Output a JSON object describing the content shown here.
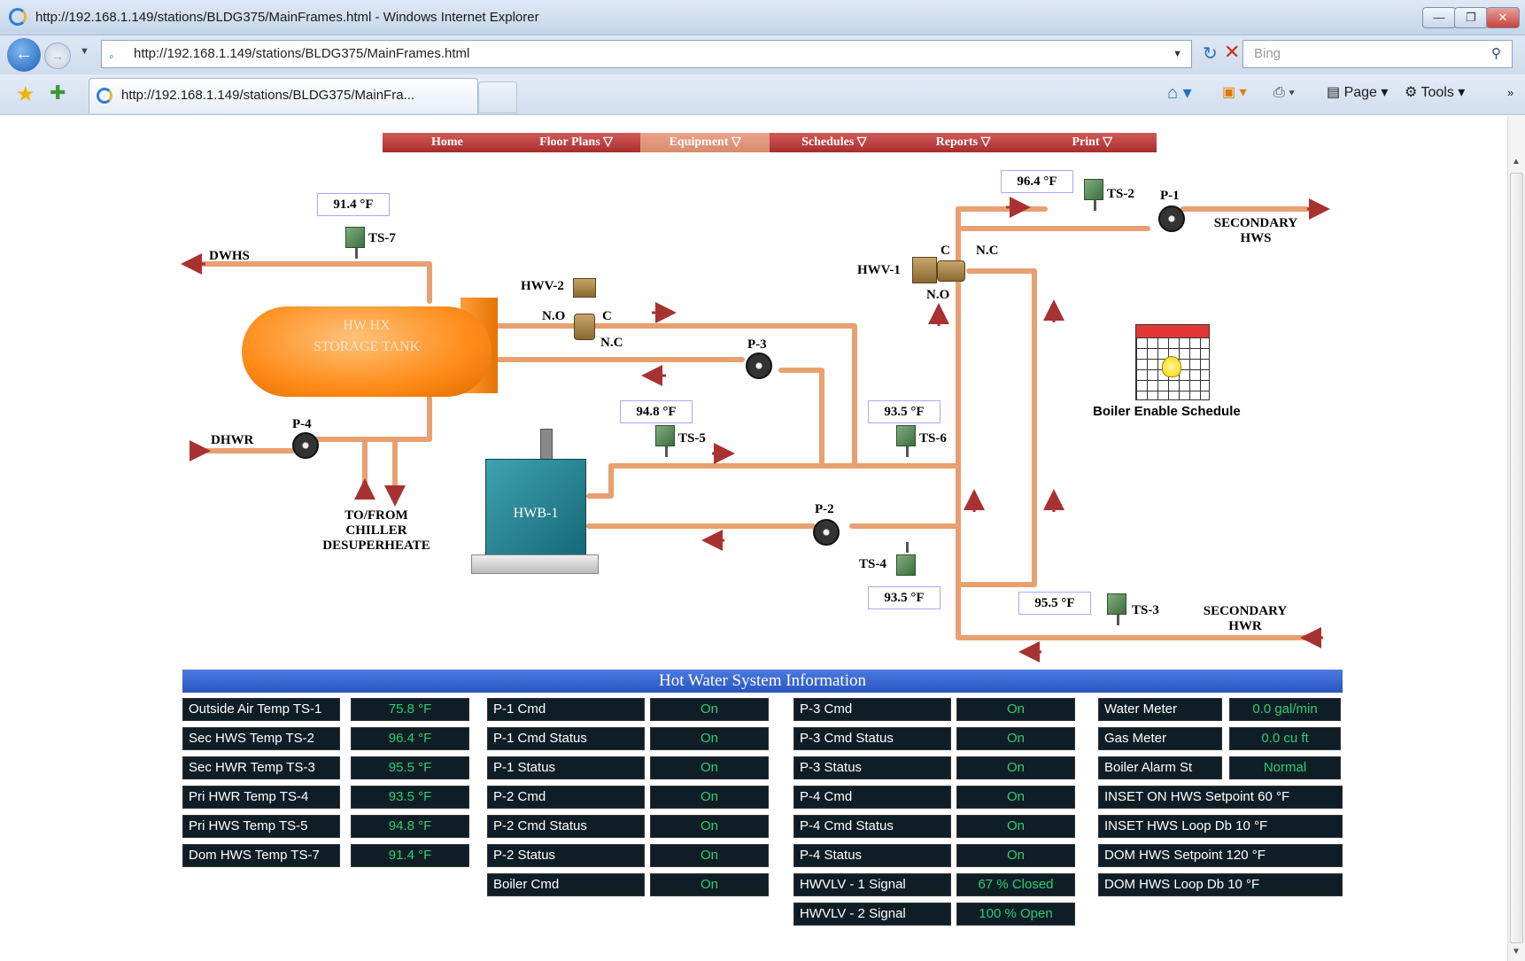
{
  "browser": {
    "window_title": "http://192.168.1.149/stations/BLDG375/MainFrames.html - Windows Internet Explorer",
    "url": "http://192.168.1.149/stations/BLDG375/MainFrames.html",
    "search_placeholder": "Bing",
    "tab_title": "http://192.168.1.149/stations/BLDG375/MainFra...",
    "commands": {
      "page": "Page",
      "tools": "Tools"
    }
  },
  "menu": {
    "items": [
      "Home",
      "Floor Plans",
      "Equipment",
      "Schedules",
      "Reports",
      "Print"
    ],
    "active": "Equipment"
  },
  "schematic": {
    "tank_line1": "HW HX",
    "tank_line2": "STORAGE TANK",
    "boiler": "HWB-1",
    "labels": {
      "dwhs": "DWHS",
      "dhwr": "DHWR",
      "ts7": "TS-7",
      "ts2": "TS-2",
      "ts5": "TS-5",
      "ts6": "TS-6",
      "ts4": "TS-4",
      "ts3": "TS-3",
      "p1": "P-1",
      "p2": "P-2",
      "p3": "P-3",
      "p4": "P-4",
      "hwv2": "HWV-2",
      "hwv1": "HWV-1",
      "no_l": "N.O",
      "c_l": "C",
      "nc_l": "N.C",
      "c_r": "C",
      "nc_r": "N.C",
      "no_r": "N.O",
      "chiller1": "TO/FROM",
      "chiller2": "CHILLER",
      "chiller3": "DESUPERHEATE",
      "hws1": "SECONDARY",
      "hws2": "HWS",
      "hwr1": "SECONDARY",
      "hwr2": "HWR",
      "schedule": "Boiler Enable Schedule"
    },
    "temps": {
      "ts7": "91.4 °F",
      "ts2": "96.4 °F",
      "ts5": "94.8 °F",
      "ts6": "93.5 °F",
      "ts4": "93.5 °F",
      "ts3": "95.5 °F"
    }
  },
  "info": {
    "title": "Hot Water System  Information",
    "col1": [
      {
        "label": "Outside Air Temp  TS-1",
        "value": "75.8 °F"
      },
      {
        "label": "Sec HWS Temp  TS-2",
        "value": "96.4 °F"
      },
      {
        "label": "Sec HWR Temp  TS-3",
        "value": "95.5 °F"
      },
      {
        "label": "Pri HWR Temp     TS-4",
        "value": "93.5 °F"
      },
      {
        "label": "Pri HWS Temp     TS-5",
        "value": "94.8 °F"
      },
      {
        "label": "Dom HWS Temp  TS-7",
        "value": "91.4 °F"
      }
    ],
    "col2": [
      {
        "label": "P-1 Cmd",
        "value": "On"
      },
      {
        "label": "P-1 Cmd Status",
        "value": "On"
      },
      {
        "label": "P-1 Status",
        "value": "On"
      },
      {
        "label": "P-2 Cmd",
        "value": "On"
      },
      {
        "label": "P-2 Cmd Status",
        "value": "On"
      },
      {
        "label": "P-2 Status",
        "value": "On"
      },
      {
        "label": "Boiler Cmd",
        "value": "On"
      }
    ],
    "col3": [
      {
        "label": "P-3 Cmd",
        "value": "On"
      },
      {
        "label": "P-3 Cmd Status",
        "value": "On"
      },
      {
        "label": "P-3 Status",
        "value": "On"
      },
      {
        "label": "P-4 Cmd",
        "value": "On"
      },
      {
        "label": "P-4 Cmd Status",
        "value": "On"
      },
      {
        "label": "P-4 Status",
        "value": "On"
      },
      {
        "label": "HWVLV - 1  Signal",
        "value": "67 % Closed"
      },
      {
        "label": "HWVLV - 2  Signal",
        "value": "100 % Open"
      }
    ],
    "col4": [
      {
        "label": "Water Meter",
        "value": "0.0 gal/min"
      },
      {
        "label": "Gas Meter",
        "value": "0.0 cu ft"
      },
      {
        "label": "Boiler Alarm St",
        "value": "Normal"
      }
    ],
    "col4_wide": [
      "INSET ON HWS Setpoint   60 °F",
      "INSET HWS Loop Db   10 °F",
      "DOM HWS Setpoint   120 °F",
      "DOM HWS Loop Db   10 °F"
    ]
  },
  "colors": {
    "pipe": "#e8a070",
    "arrow": "#a83232",
    "menu": "#b83a3a",
    "value_green": "#2ecc71",
    "info_header": "#2a55c0"
  }
}
